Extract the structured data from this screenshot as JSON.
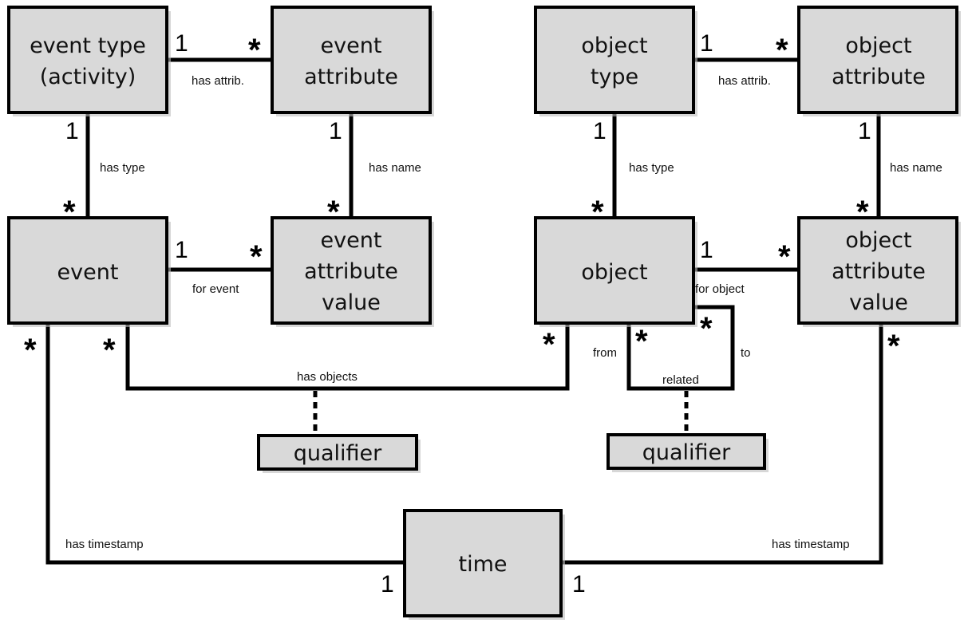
{
  "diagram": {
    "entities": {
      "event_type": [
        "event type",
        "(activity)"
      ],
      "event_attribute": [
        "event",
        "attribute"
      ],
      "event": [
        "event"
      ],
      "event_attribute_value": [
        "event",
        "attribute",
        "value"
      ],
      "object_type": [
        "object",
        "type"
      ],
      "object_attribute": [
        "object",
        "attribute"
      ],
      "object": [
        "object"
      ],
      "object_attribute_value": [
        "object",
        "attribute",
        "value"
      ],
      "qualifier_objects": [
        "qualifier"
      ],
      "qualifier_related": [
        "qualifier"
      ],
      "time": [
        "time"
      ]
    },
    "relations": {
      "event_has_attrib": "has attrib.",
      "event_has_type": "has type",
      "event_has_name": "has name",
      "for_event": "for event",
      "object_has_attrib": "has attrib.",
      "object_has_type": "has type",
      "object_has_name": "has name",
      "for_object": "for object",
      "has_objects": "has objects",
      "from": "from",
      "to": "to",
      "related": "related",
      "event_has_timestamp": "has timestamp",
      "object_has_timestamp": "has timestamp"
    },
    "multiplicities": {
      "one": "1",
      "many": "*"
    }
  }
}
